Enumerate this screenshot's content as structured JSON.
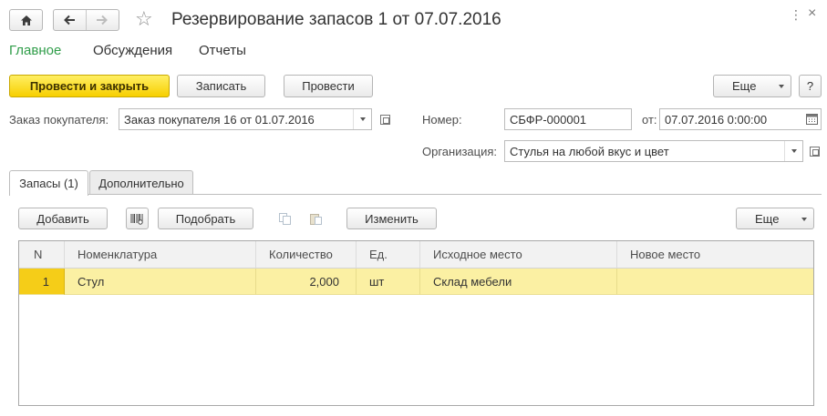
{
  "window": {
    "title": "Резервирование запасов 1 от 07.07.2016",
    "icons": [
      "home-icon",
      "back-arrow-icon",
      "forward-arrow-icon",
      "star-icon",
      "more-dots-icon",
      "close-icon"
    ],
    "more_glyph": "⋮",
    "close_glyph": "×"
  },
  "sections": [
    "Главное",
    "Обсуждения",
    "Отчеты"
  ],
  "toolbar": {
    "post_and_close": "Провести и закрыть",
    "save": "Записать",
    "post": "Провести",
    "more": "Еще",
    "help": "?"
  },
  "fields": {
    "order_label": "Заказ покупателя:",
    "order_value": "Заказ покупателя 16 от 01.07.2016",
    "number_label": "Номер:",
    "number_value": "СБФР-000001",
    "date_label": "от:",
    "date_value": "07.07.2016  0:00:00",
    "org_label": "Организация:",
    "org_value": "Стулья на любой вкус и цвет"
  },
  "tabs": [
    "Запасы (1)",
    "Дополнительно"
  ],
  "table_toolbar": {
    "add": "Добавить",
    "pick": "Подобрать",
    "change": "Изменить",
    "more": "Еще"
  },
  "table": {
    "columns": [
      "N",
      "Номенклатура",
      "Количество",
      "Ед.",
      "Исходное место",
      "Новое место"
    ],
    "rows": [
      {
        "n": "1",
        "item": "Стул",
        "qty": "2,000",
        "unit": "шт",
        "source": "Склад мебели",
        "target": ""
      }
    ]
  },
  "colors": {
    "accent_green": "#2f9d49",
    "primary_button": "#f7cf00",
    "selected_row": "#fbf0a3",
    "selected_cell": "#f5cd18"
  }
}
